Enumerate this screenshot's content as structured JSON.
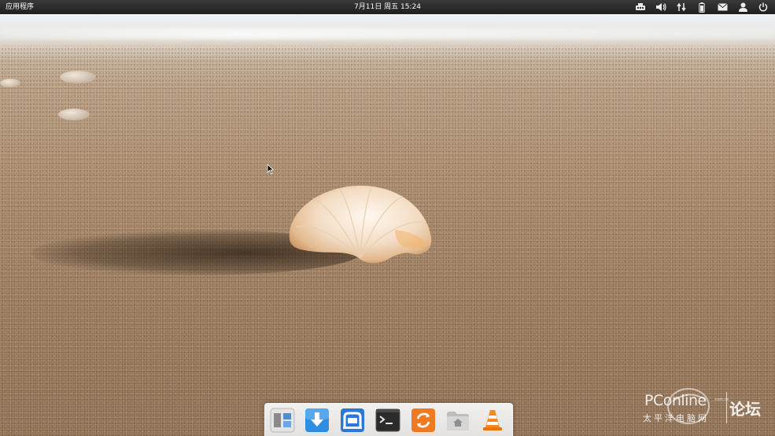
{
  "top_panel": {
    "apps_menu_label": "应用程序",
    "datetime": "7月11日 周五 15:24",
    "indicators": [
      {
        "name": "network-icon"
      },
      {
        "name": "volume-icon"
      },
      {
        "name": "transfer-icon"
      },
      {
        "name": "battery-icon"
      },
      {
        "name": "mail-icon"
      },
      {
        "name": "user-icon"
      },
      {
        "name": "power-icon"
      }
    ]
  },
  "dock": {
    "items": [
      {
        "name": "multitasking-view-icon",
        "color": "#d8d8d8"
      },
      {
        "name": "download-manager-icon",
        "color": "#2f8ee0"
      },
      {
        "name": "software-center-icon",
        "color": "#2a78d8"
      },
      {
        "name": "terminal-icon",
        "color": "#2b2b2b"
      },
      {
        "name": "update-manager-icon",
        "color": "#f07a22"
      },
      {
        "name": "home-folder-icon",
        "color": "#c9c9c9"
      },
      {
        "name": "vlc-icon",
        "color": "#f58b1f"
      }
    ],
    "running": "software-center-icon"
  },
  "watermark": {
    "brand": "PConline",
    "domain": ".com.cn",
    "sub": "太平洋电脑网",
    "forum": "论坛"
  }
}
